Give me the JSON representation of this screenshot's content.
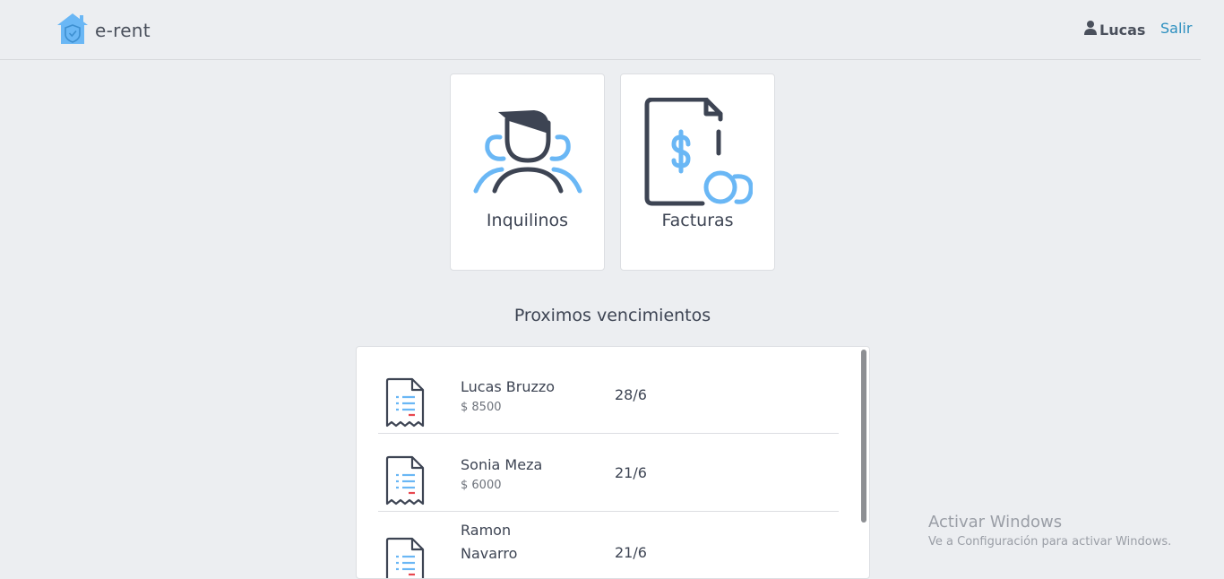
{
  "app": {
    "brand": "e-rent"
  },
  "header": {
    "user_name": "Lucas",
    "logout_label": "Salir"
  },
  "cards": [
    {
      "label": "Inquilinos",
      "icon": "tenants-icon"
    },
    {
      "label": "Facturas",
      "icon": "invoice-icon"
    }
  ],
  "section": {
    "title": "Proximos vencimientos"
  },
  "due_list": [
    {
      "name": "Lucas Bruzzo",
      "amount": "$ 8500",
      "date": "28/6"
    },
    {
      "name": "Sonia Meza",
      "amount": "$ 6000",
      "date": "21/6"
    },
    {
      "name": "Ramon Navarro",
      "amount": "",
      "date": "21/6"
    }
  ],
  "watermark": {
    "line1": "Activar Windows",
    "line2": "Ve a Configuración para activar Windows."
  },
  "colors": {
    "accent": "#6ab7f5",
    "dark": "#3d4453",
    "link": "#2c8fbf",
    "background": "#eceef1"
  }
}
